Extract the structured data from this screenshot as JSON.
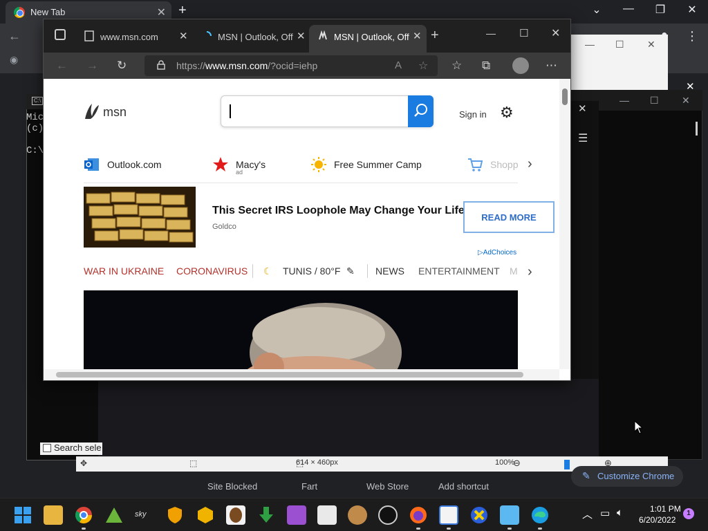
{
  "chrome": {
    "tab_title": "New Tab",
    "new_tab": "+",
    "shortcuts": [
      "Site Blocked",
      "Fart",
      "Web Store",
      "Add shortcut"
    ],
    "customize": "Customize Chrome"
  },
  "cmd": {
    "text": "Mic\n(c)\n\nC:\\"
  },
  "editor": {
    "search_label": "Search sele",
    "dimensions": "614 × 460px",
    "zoom": "100%"
  },
  "edge": {
    "tabs": [
      {
        "title": "www.msn.com"
      },
      {
        "title": "MSN | Outlook, Off"
      },
      {
        "title": "MSN | Outlook, Off"
      }
    ],
    "url_prefix": "https://",
    "url_host": "www.msn.com",
    "url_path": "/?ocid=iehp"
  },
  "msn": {
    "logo": "msn",
    "sign_in": "Sign in",
    "quick_links": [
      {
        "label": "Outlook.com"
      },
      {
        "label": "Macy's",
        "sub": "ad"
      },
      {
        "label": "Free Summer Camp"
      },
      {
        "label": "Shopp"
      }
    ],
    "ad": {
      "title": "This Secret IRS Loophole May Change Your Life",
      "source": "Goldco",
      "button": "READ MORE",
      "adchoices": "AdChoices"
    },
    "topics": {
      "war": "WAR IN UKRAINE",
      "corona": "CORONAVIRUS",
      "weather": "TUNIS / 80°F",
      "news": "NEWS",
      "entertainment": "ENTERTAINMENT",
      "more": "M"
    }
  },
  "taskbar": {
    "time": "1:01 PM",
    "date": "6/20/2022",
    "notifications": "1"
  }
}
